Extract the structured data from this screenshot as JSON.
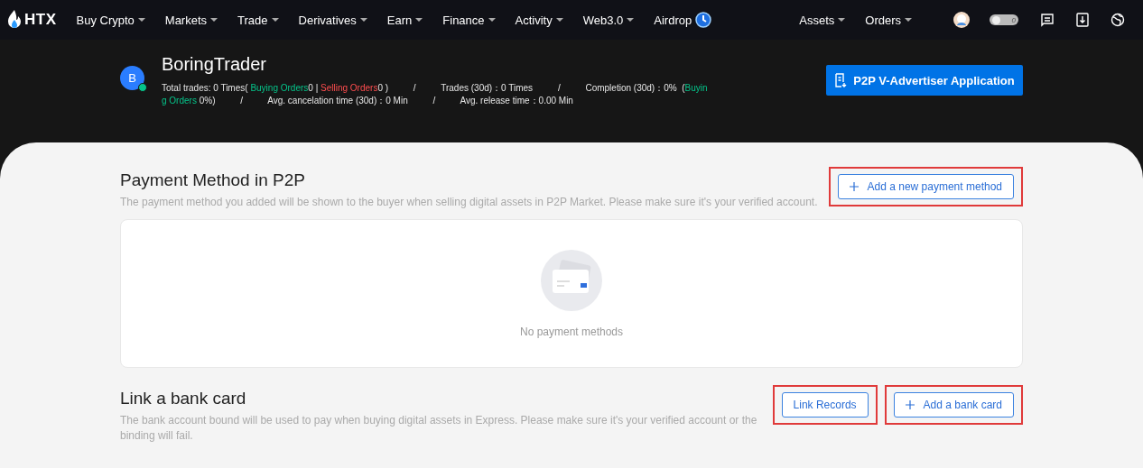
{
  "nav": {
    "logo": "HTX",
    "items": [
      {
        "label": "Buy Crypto",
        "dropdown": true
      },
      {
        "label": "Markets",
        "dropdown": true
      },
      {
        "label": "Trade",
        "dropdown": true
      },
      {
        "label": "Derivatives",
        "dropdown": true
      },
      {
        "label": "Earn",
        "dropdown": true
      },
      {
        "label": "Finance",
        "dropdown": true
      },
      {
        "label": "Activity",
        "dropdown": true
      },
      {
        "label": "Web3.0",
        "dropdown": true
      },
      {
        "label": "Airdrop",
        "dropdown": false
      }
    ],
    "right_items": [
      {
        "label": "Assets",
        "dropdown": true
      },
      {
        "label": "Orders",
        "dropdown": true
      }
    ],
    "notification_count": "0"
  },
  "profile": {
    "avatar_letter": "B",
    "online": true,
    "name": "BoringTrader",
    "stats": [
      {
        "kind": "text",
        "text": "Total trades: 0 Times( "
      },
      {
        "kind": "buy",
        "text": "Buying Orders"
      },
      {
        "kind": "text",
        "text": "0 | "
      },
      {
        "kind": "sell",
        "text": "Selling Orders"
      },
      {
        "kind": "text",
        "text": "0 )          /          Trades (30d)：0 Times          /          Completion (30d)：0%  ("
      },
      {
        "kind": "buy",
        "text": "Buying Orders"
      },
      {
        "kind": "text",
        "text": " 0%)          /          Avg. cancelation time (30d)：0 Min          /          Avg. release time：0.00 Min"
      }
    ],
    "apply_button": "P2P V-Advertiser Application"
  },
  "sections": [
    {
      "title": "Payment Method in P2P",
      "description": "The payment method you added will be shown to the buyer when selling digital assets in P2P Market. Please make sure it's your verified account.",
      "buttons": [
        {
          "label": "Add a new payment method",
          "plus": true,
          "highlighted": true
        }
      ],
      "empty_text": "No payment methods"
    },
    {
      "title": "Link a bank card",
      "description": "The bank account bound will be used to pay when buying digital assets in Express. Please make sure it's your verified account or the binding will fail.",
      "buttons": [
        {
          "label": "Link Records",
          "plus": false,
          "highlighted": true
        },
        {
          "label": "Add a bank card",
          "plus": true,
          "highlighted": true
        }
      ]
    }
  ]
}
